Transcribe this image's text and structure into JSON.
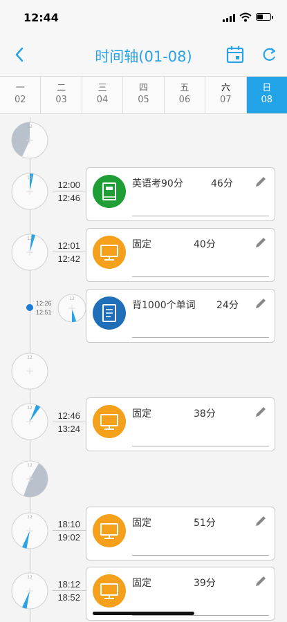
{
  "status": {
    "time": "12:44"
  },
  "nav": {
    "title": "时间轴(01-08)"
  },
  "week": [
    {
      "name": "一",
      "date": "02"
    },
    {
      "name": "二",
      "date": "03"
    },
    {
      "name": "三",
      "date": "04"
    },
    {
      "name": "四",
      "date": "05"
    },
    {
      "name": "五",
      "date": "06"
    },
    {
      "name": "六",
      "date": "07"
    },
    {
      "name": "日",
      "date": "08"
    }
  ],
  "entries": [
    {
      "start": "12:00",
      "end": "12:46",
      "task": "英语考90分",
      "duration": "46分",
      "icon": "book-icon",
      "color": "#1e9e35"
    },
    {
      "start": "12:01",
      "end": "12:42",
      "task": "固定",
      "duration": "40分",
      "icon": "monitor-icon",
      "color": "#f5a01a"
    },
    {
      "start": "12:26",
      "end": "12:51",
      "task": "背1000个单词",
      "duration": "24分",
      "icon": "notebook-icon",
      "color": "#1f6fb8"
    },
    {
      "start": "12:46",
      "end": "13:24",
      "task": "固定",
      "duration": "38分",
      "icon": "monitor-icon",
      "color": "#f5a01a"
    },
    {
      "start": "18:10",
      "end": "19:02",
      "task": "固定",
      "duration": "51分",
      "icon": "monitor-icon",
      "color": "#f5a01a"
    },
    {
      "start": "18:12",
      "end": "18:52",
      "task": "固定",
      "duration": "39分",
      "icon": "monitor-icon",
      "color": "#f5a01a"
    }
  ],
  "colors": {
    "accent": "#23a4e8",
    "clock_fill": "#29a3e6",
    "gap_fill": "#b9c2cc"
  }
}
